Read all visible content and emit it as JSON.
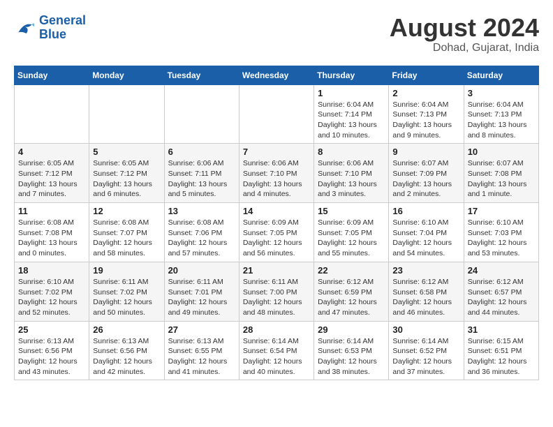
{
  "header": {
    "logo_line1": "General",
    "logo_line2": "Blue",
    "month": "August 2024",
    "location": "Dohad, Gujarat, India"
  },
  "weekdays": [
    "Sunday",
    "Monday",
    "Tuesday",
    "Wednesday",
    "Thursday",
    "Friday",
    "Saturday"
  ],
  "weeks": [
    [
      {
        "day": "",
        "info": ""
      },
      {
        "day": "",
        "info": ""
      },
      {
        "day": "",
        "info": ""
      },
      {
        "day": "",
        "info": ""
      },
      {
        "day": "1",
        "info": "Sunrise: 6:04 AM\nSunset: 7:14 PM\nDaylight: 13 hours\nand 10 minutes."
      },
      {
        "day": "2",
        "info": "Sunrise: 6:04 AM\nSunset: 7:13 PM\nDaylight: 13 hours\nand 9 minutes."
      },
      {
        "day": "3",
        "info": "Sunrise: 6:04 AM\nSunset: 7:13 PM\nDaylight: 13 hours\nand 8 minutes."
      }
    ],
    [
      {
        "day": "4",
        "info": "Sunrise: 6:05 AM\nSunset: 7:12 PM\nDaylight: 13 hours\nand 7 minutes."
      },
      {
        "day": "5",
        "info": "Sunrise: 6:05 AM\nSunset: 7:12 PM\nDaylight: 13 hours\nand 6 minutes."
      },
      {
        "day": "6",
        "info": "Sunrise: 6:06 AM\nSunset: 7:11 PM\nDaylight: 13 hours\nand 5 minutes."
      },
      {
        "day": "7",
        "info": "Sunrise: 6:06 AM\nSunset: 7:10 PM\nDaylight: 13 hours\nand 4 minutes."
      },
      {
        "day": "8",
        "info": "Sunrise: 6:06 AM\nSunset: 7:10 PM\nDaylight: 13 hours\nand 3 minutes."
      },
      {
        "day": "9",
        "info": "Sunrise: 6:07 AM\nSunset: 7:09 PM\nDaylight: 13 hours\nand 2 minutes."
      },
      {
        "day": "10",
        "info": "Sunrise: 6:07 AM\nSunset: 7:08 PM\nDaylight: 13 hours\nand 1 minute."
      }
    ],
    [
      {
        "day": "11",
        "info": "Sunrise: 6:08 AM\nSunset: 7:08 PM\nDaylight: 13 hours\nand 0 minutes."
      },
      {
        "day": "12",
        "info": "Sunrise: 6:08 AM\nSunset: 7:07 PM\nDaylight: 12 hours\nand 58 minutes."
      },
      {
        "day": "13",
        "info": "Sunrise: 6:08 AM\nSunset: 7:06 PM\nDaylight: 12 hours\nand 57 minutes."
      },
      {
        "day": "14",
        "info": "Sunrise: 6:09 AM\nSunset: 7:05 PM\nDaylight: 12 hours\nand 56 minutes."
      },
      {
        "day": "15",
        "info": "Sunrise: 6:09 AM\nSunset: 7:05 PM\nDaylight: 12 hours\nand 55 minutes."
      },
      {
        "day": "16",
        "info": "Sunrise: 6:10 AM\nSunset: 7:04 PM\nDaylight: 12 hours\nand 54 minutes."
      },
      {
        "day": "17",
        "info": "Sunrise: 6:10 AM\nSunset: 7:03 PM\nDaylight: 12 hours\nand 53 minutes."
      }
    ],
    [
      {
        "day": "18",
        "info": "Sunrise: 6:10 AM\nSunset: 7:02 PM\nDaylight: 12 hours\nand 52 minutes."
      },
      {
        "day": "19",
        "info": "Sunrise: 6:11 AM\nSunset: 7:02 PM\nDaylight: 12 hours\nand 50 minutes."
      },
      {
        "day": "20",
        "info": "Sunrise: 6:11 AM\nSunset: 7:01 PM\nDaylight: 12 hours\nand 49 minutes."
      },
      {
        "day": "21",
        "info": "Sunrise: 6:11 AM\nSunset: 7:00 PM\nDaylight: 12 hours\nand 48 minutes."
      },
      {
        "day": "22",
        "info": "Sunrise: 6:12 AM\nSunset: 6:59 PM\nDaylight: 12 hours\nand 47 minutes."
      },
      {
        "day": "23",
        "info": "Sunrise: 6:12 AM\nSunset: 6:58 PM\nDaylight: 12 hours\nand 46 minutes."
      },
      {
        "day": "24",
        "info": "Sunrise: 6:12 AM\nSunset: 6:57 PM\nDaylight: 12 hours\nand 44 minutes."
      }
    ],
    [
      {
        "day": "25",
        "info": "Sunrise: 6:13 AM\nSunset: 6:56 PM\nDaylight: 12 hours\nand 43 minutes."
      },
      {
        "day": "26",
        "info": "Sunrise: 6:13 AM\nSunset: 6:56 PM\nDaylight: 12 hours\nand 42 minutes."
      },
      {
        "day": "27",
        "info": "Sunrise: 6:13 AM\nSunset: 6:55 PM\nDaylight: 12 hours\nand 41 minutes."
      },
      {
        "day": "28",
        "info": "Sunrise: 6:14 AM\nSunset: 6:54 PM\nDaylight: 12 hours\nand 40 minutes."
      },
      {
        "day": "29",
        "info": "Sunrise: 6:14 AM\nSunset: 6:53 PM\nDaylight: 12 hours\nand 38 minutes."
      },
      {
        "day": "30",
        "info": "Sunrise: 6:14 AM\nSunset: 6:52 PM\nDaylight: 12 hours\nand 37 minutes."
      },
      {
        "day": "31",
        "info": "Sunrise: 6:15 AM\nSunset: 6:51 PM\nDaylight: 12 hours\nand 36 minutes."
      }
    ]
  ]
}
